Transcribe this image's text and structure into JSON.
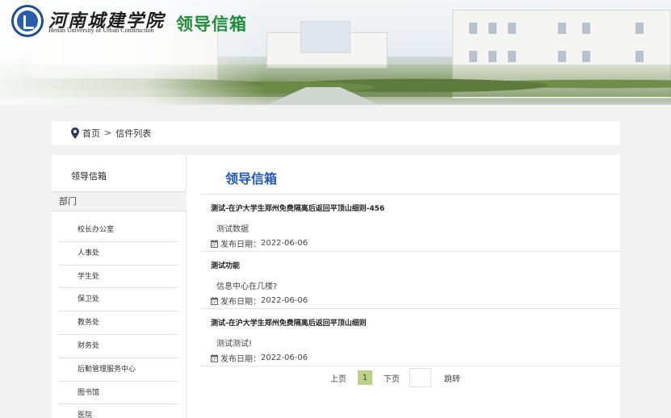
{
  "header": {
    "school_name_cn": "河南城建学院",
    "school_name_en": "Henan University of Urban Construction",
    "site_title": "领导信箱"
  },
  "breadcrumb": {
    "icon": "map-pin-icon",
    "home": "首页",
    "separator": ">",
    "current": "信件列表"
  },
  "sidebar": {
    "title": "领导信箱",
    "section_header": "部门",
    "items": [
      {
        "label": "校长办公室"
      },
      {
        "label": "人事处"
      },
      {
        "label": "学生处"
      },
      {
        "label": "保卫处"
      },
      {
        "label": "教务处"
      },
      {
        "label": "财务处"
      },
      {
        "label": "后勤管理服务中心"
      },
      {
        "label": "图书馆"
      },
      {
        "label": "医院"
      }
    ]
  },
  "content": {
    "title": "领导信箱",
    "date_prefix": "发布日期：",
    "letters": [
      {
        "title": "测试-在沪大学生郑州免费隔离后返回平顶山细则-456",
        "desc": "测试数据",
        "date": "2022-06-06"
      },
      {
        "title": "测试功能",
        "desc": "信息中心在几楼?",
        "date": "2022-06-06"
      },
      {
        "title": "测试-在沪大学生郑州免费隔离后返回平顶山细则",
        "desc": "测试测试!",
        "date": "2022-06-06"
      }
    ]
  },
  "pager": {
    "prev": "上页",
    "current_page": "1",
    "next": "下页",
    "jump_value": "",
    "jump": "跳转"
  },
  "colors": {
    "site_title": "#1d8d3a",
    "content_title": "#1f57b4",
    "current_page_bg": "#bcd08a",
    "page_bg": "#f2f2f2"
  }
}
